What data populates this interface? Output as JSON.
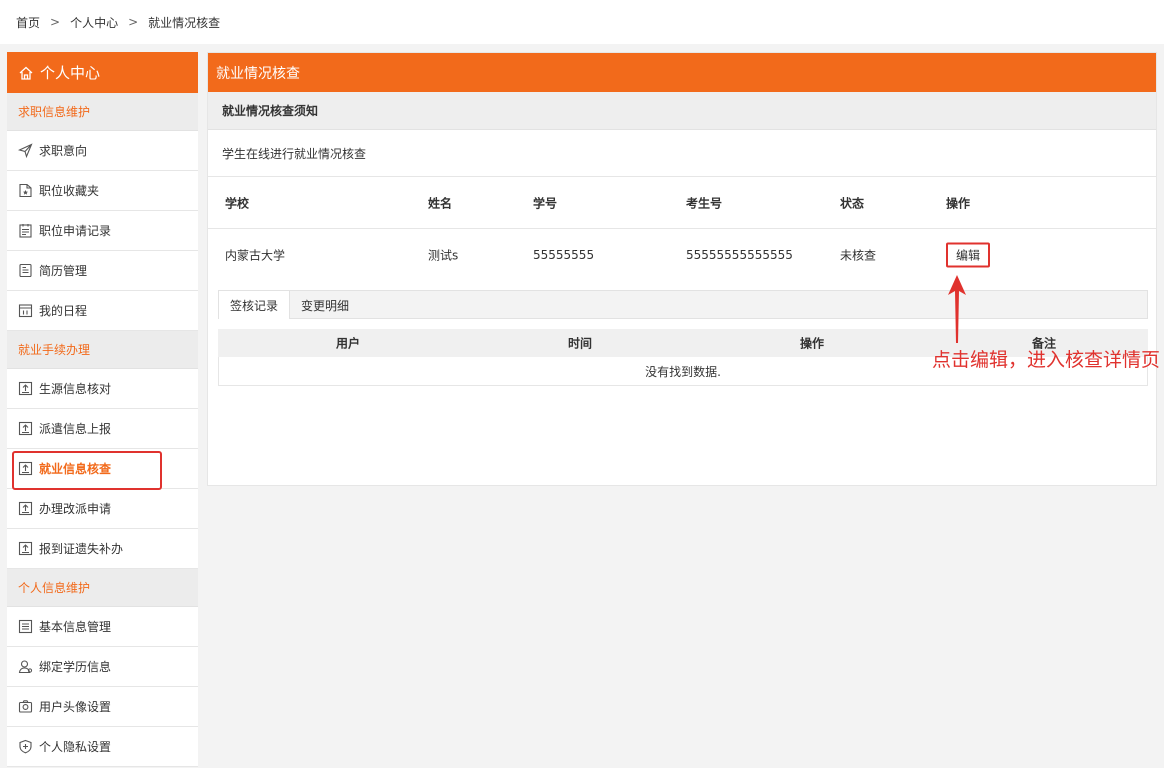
{
  "breadcrumb": {
    "home": "首页",
    "sep": ">",
    "center": "个人中心",
    "current": "就业情况核查"
  },
  "sidebar": {
    "title": "个人中心",
    "sections": [
      {
        "label": "求职信息维护",
        "items": [
          {
            "label": "求职意向",
            "icon": "paper-plane-icon"
          },
          {
            "label": "职位收藏夹",
            "icon": "favorite-folder-icon"
          },
          {
            "label": "职位申请记录",
            "icon": "application-record-icon"
          },
          {
            "label": "简历管理",
            "icon": "resume-icon"
          },
          {
            "label": "我的日程",
            "icon": "calendar-icon"
          }
        ]
      },
      {
        "label": "就业手续办理",
        "items": [
          {
            "label": "生源信息核对",
            "icon": "upload-doc-icon"
          },
          {
            "label": "派遣信息上报",
            "icon": "upload-doc-icon"
          },
          {
            "label": "就业信息核查",
            "icon": "upload-doc-icon",
            "active": true
          },
          {
            "label": "办理改派申请",
            "icon": "upload-doc-icon"
          },
          {
            "label": "报到证遗失补办",
            "icon": "upload-doc-icon"
          }
        ]
      },
      {
        "label": "个人信息维护",
        "items": [
          {
            "label": "基本信息管理",
            "icon": "list-doc-icon"
          },
          {
            "label": "绑定学历信息",
            "icon": "user-icon"
          },
          {
            "label": "用户头像设置",
            "icon": "camera-icon"
          },
          {
            "label": "个人隐私设置",
            "icon": "shield-icon"
          }
        ]
      }
    ]
  },
  "main": {
    "title": "就业情况核查",
    "notice_title": "就业情况核查须知",
    "notice_text": "学生在线进行就业情况核查",
    "table": {
      "headers": [
        "学校",
        "姓名",
        "学号",
        "考生号",
        "状态",
        "操作"
      ],
      "row": {
        "school": "内蒙古大学",
        "name": "测试s",
        "student_id": "55555555",
        "exam_id": "55555555555555",
        "status": "未核查",
        "action": "编辑"
      }
    },
    "tabs": [
      "签核记录",
      "变更明细"
    ],
    "sub_table": {
      "headers": [
        "用户",
        "时间",
        "操作",
        "备注"
      ],
      "empty": "没有找到数据."
    }
  },
  "annotation": {
    "text": "点击编辑，进入核查详情页",
    "color": "#e0322e"
  },
  "colors": {
    "accent": "#f26a1b",
    "highlight": "#e0322e"
  }
}
